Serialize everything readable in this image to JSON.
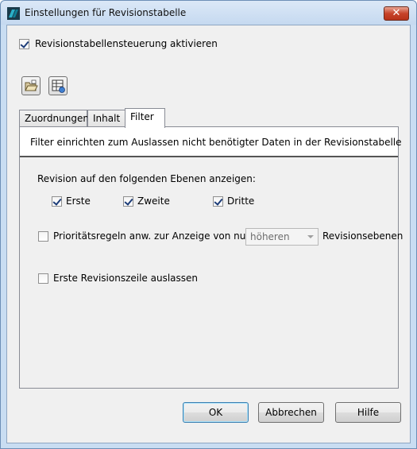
{
  "window": {
    "title": "Einstellungen für Revisionstabelle",
    "close_label": "✕",
    "icon": "autodesk-logo-icon"
  },
  "main_checkbox": {
    "label": "Revisionstabellensteuerung aktivieren",
    "checked": true
  },
  "toolbar": {
    "buttons": [
      {
        "icon": "open-folder-icon"
      },
      {
        "icon": "table-settings-icon"
      }
    ]
  },
  "tabs": [
    {
      "label": "Zuordnungen",
      "active": false
    },
    {
      "label": "Inhalt",
      "active": false
    },
    {
      "label": "Filter",
      "active": true
    }
  ],
  "filter": {
    "description": "Filter einrichten zum Auslassen nicht benötigter Daten in der Revisionstabelle",
    "levels_heading": "Revision auf den folgenden Ebenen anzeigen:",
    "levels": [
      {
        "label": "Erste",
        "checked": true
      },
      {
        "label": "Zweite",
        "checked": true
      },
      {
        "label": "Dritte",
        "checked": true
      }
    ],
    "priority": {
      "label": "Prioritätsregeln anw. zur Anzeige von nur",
      "checked": false,
      "dropdown_value": "höheren",
      "suffix": "Revisionsebenen"
    },
    "skip_first": {
      "label": "Erste Revisionszeile auslassen",
      "checked": false
    }
  },
  "buttons": {
    "ok": "OK",
    "cancel": "Abbrechen",
    "help": "Hilfe"
  },
  "colors": {
    "title_bar": "#c9ddf2",
    "client_bg": "#f0f0f0",
    "close_red": "#c7432a",
    "checkmark": "#1c3c78"
  }
}
